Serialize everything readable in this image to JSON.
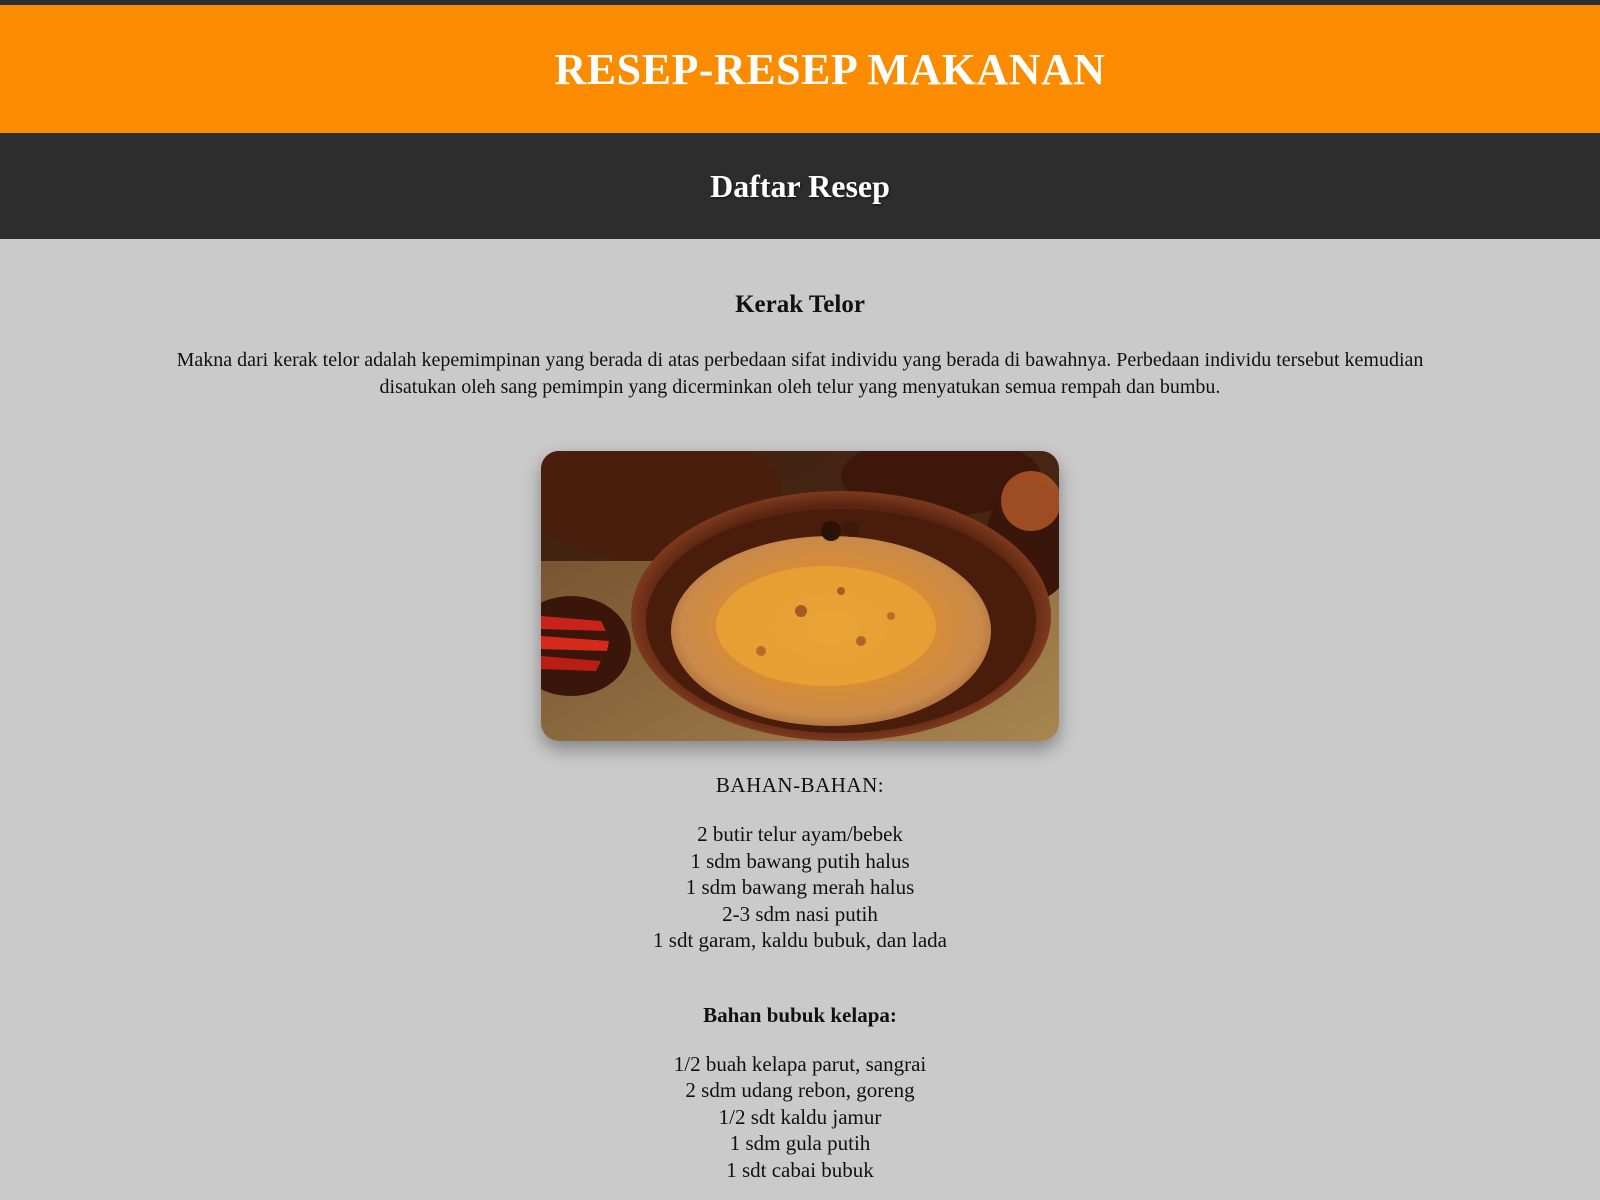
{
  "header": {
    "title": "RESEP-RESEP MAKANAN"
  },
  "nav": {
    "title": "Daftar Resep"
  },
  "recipe": {
    "title": "Kerak Telor",
    "description": "Makna dari kerak telor adalah kepemimpinan yang berada di atas perbedaan sifat individu yang berada di bawahnya. Perbedaan individu tersebut kemudian disatukan oleh sang pemimpin yang dicerminkan oleh telur yang menyatukan semua rempah dan bumbu.",
    "ingredients_heading": "BAHAN-BAHAN:",
    "ingredients": [
      "2 butir telur ayam/bebek",
      "1 sdm bawang putih halus",
      "1 sdm bawang merah halus",
      "2-3 sdm nasi putih",
      "1 sdt garam, kaldu bubuk, dan lada"
    ],
    "coconut_heading": "Bahan bubuk kelapa:",
    "coconut_ingredients": [
      "1/2 buah kelapa parut, sangrai",
      "2 sdm udang rebon, goreng",
      "1/2 sdt kaldu jamur",
      "1 sdm gula putih",
      "1 sdt cabai bubuk"
    ]
  },
  "colors": {
    "header_bg": "#fb8c00",
    "nav_bg": "#2d2d2d",
    "page_bg": "#cacaca"
  }
}
